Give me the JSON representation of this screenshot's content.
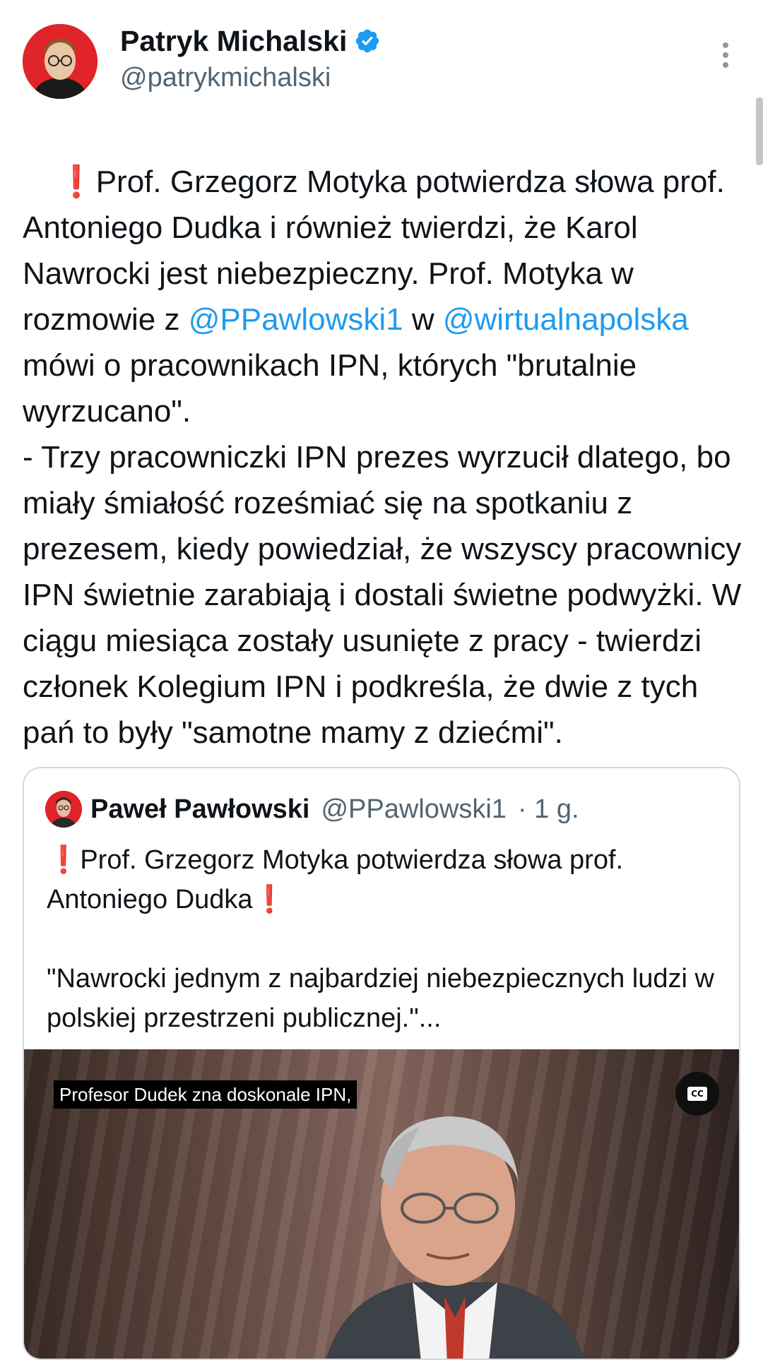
{
  "author": {
    "display_name": "Patryk Michalski",
    "handle": "@patrykmichalski",
    "verified": true,
    "verified_color": "#1d9bf0",
    "avatar_icon": "avatar-photo"
  },
  "tweet": {
    "segments": [
      {
        "type": "excl",
        "text": "❗"
      },
      {
        "type": "text",
        "text": "Prof. Grzegorz Motyka potwierdza słowa prof. Antoniego Dudka i również twierdzi, że Karol Nawrocki jest niebezpieczny. Prof. Motyka w rozmowie z "
      },
      {
        "type": "mention",
        "text": "@PPawlowski1"
      },
      {
        "type": "text",
        "text": " w "
      },
      {
        "type": "mention",
        "text": "@wirtualnapolska"
      },
      {
        "type": "text",
        "text": " mówi o pracownikach IPN, których \"brutalnie wyrzucano\".\n- Trzy pracowniczki IPN prezes wyrzucił dlatego, bo miały śmiałość roześmiać się na spotkaniu z prezesem, kiedy powiedział, że wszyscy pracownicy IPN świetnie zarabiają i dostali świetne podwyżki. W ciągu miesiąca zostały usunięte z pracy - twierdzi członek Kolegium IPN i podkreśla, że dwie z tych pań to były \"samotne mamy z dziećmi\"."
      }
    ]
  },
  "quote": {
    "display_name": "Paweł Pawłowski",
    "handle": "@PPawlowski1",
    "time": "· 1 g.",
    "text_line1_prefix": "❗",
    "text_line1": "Prof. Grzegorz Motyka potwierdza słowa prof. Antoniego Dudka",
    "text_line1_suffix": "❗",
    "text_line2": "\"Nawrocki jednym z najbardziej niebezpiecznych ludzi w polskiej przestrzeni publicznej.\"...",
    "video_caption": "Profesor Dudek zna doskonale IPN,",
    "cc_label": "CC"
  },
  "colors": {
    "mention": "#1d9bf0",
    "text": "#0f1419",
    "secondary": "#536471",
    "exclamation": "#e0242a"
  }
}
